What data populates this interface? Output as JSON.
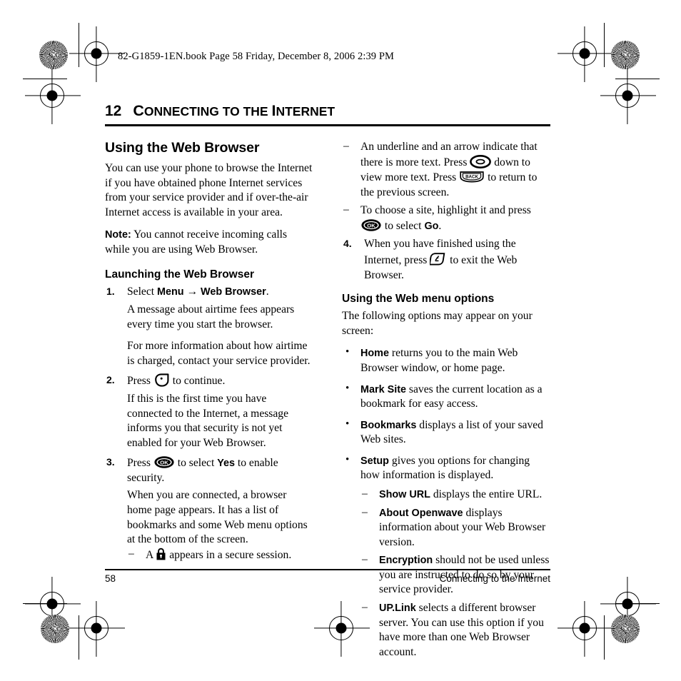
{
  "file_header": "82-G1859-1EN.book  Page 58  Friday, December 8, 2006  2:39 PM",
  "chapter": {
    "number": "12",
    "title_first": "C",
    "title_rest": "ONNECTING TO THE ",
    "title_cap2": "I",
    "title_rest2": "NTERNET",
    "title_plain": "CONNECTING TO THE INTERNET"
  },
  "left_column": {
    "section_heading": "Using the Web Browser",
    "intro": "You can use your phone to browse the Internet if you have obtained phone Internet services from your service provider and if over-the-air Internet access is available in your area.",
    "note_label": "Note:",
    "note_text": "You cannot receive incoming calls while you are using Web Browser.",
    "sub_heading": "Launching the Web Browser",
    "steps": [
      {
        "num": "1.",
        "lead": "Select",
        "bold1": "Menu",
        "arrow": "→",
        "bold2": "Web Browser",
        "tail": ".",
        "paras": [
          "A message about airtime fees appears every time you start the browser.",
          "For more information about how airtime is charged, contact your service provider."
        ]
      },
      {
        "num": "2.",
        "press": "Press",
        "icon": "soft-key-icon",
        "tail": "to continue.",
        "paras": [
          "If this is the first time you have connected to the Internet, a message informs you that security is not yet enabled for your Web Browser."
        ]
      },
      {
        "num": "3.",
        "press": "Press",
        "icon": "ok-key-icon",
        "mid": "to select",
        "bold1": "Yes",
        "tail": "to enable security.",
        "paras": [
          "When you are connected, a browser home page appears. It has a list of bookmarks and some Web menu options at the bottom of the screen."
        ]
      }
    ],
    "secure_bullet": {
      "dash": "–",
      "before": "A",
      "icon": "padlock-icon",
      "after": "appears in a secure session."
    }
  },
  "right_column": {
    "dash_items": [
      {
        "dash": "–",
        "text_1": "An underline and an arrow indicate that there is more text. Press",
        "icon_1": "navigation-key-icon",
        "text_2": "down to view more text. Press",
        "icon_2": "back-key-icon",
        "text_3": "to return to the previous screen."
      },
      {
        "dash": "–",
        "text_1": "To choose a site, highlight it and press",
        "icon_1": "ok-key-icon",
        "text_2": "to select",
        "bold_1": "Go",
        "text_3": "."
      }
    ],
    "step4": {
      "num": "4.",
      "text_1": "When you have finished using the Internet, press",
      "icon": "end-key-icon",
      "text_2": "to exit the Web Browser."
    },
    "sub_heading": "Using the Web menu options",
    "intro": "The following options may appear on your screen:",
    "bullets": [
      {
        "bullet": "•",
        "term": "Home",
        "desc": "returns you to the main Web Browser window, or home page."
      },
      {
        "bullet": "•",
        "term": "Mark Site",
        "desc": "saves the current location as a bookmark for easy access."
      },
      {
        "bullet": "•",
        "term": "Bookmarks",
        "desc": "displays a list of your saved Web sites."
      },
      {
        "bullet": "•",
        "term": "Setup",
        "desc": "gives you options for changing how information is displayed."
      }
    ],
    "sub_dashes": [
      {
        "dash": "–",
        "term": "Show URL",
        "desc": "displays the entire URL."
      },
      {
        "dash": "–",
        "term": "About Openwave",
        "desc": "displays information about your Web Browser version."
      },
      {
        "dash": "–",
        "term": "Encryption",
        "desc": "should not be used unless you are instructed to do so by your service provider."
      },
      {
        "dash": "–",
        "term": "UP.Link",
        "desc": "selects a different browser server. You can use this option if you have more than one Web Browser account."
      }
    ]
  },
  "footer": {
    "page_number": "58",
    "chapter_name": "Connecting to the Internet"
  },
  "icons": {
    "ok_label": "OK",
    "back_label": "BACK"
  },
  "colors": {
    "ink": "#000000",
    "paper": "#ffffff"
  }
}
